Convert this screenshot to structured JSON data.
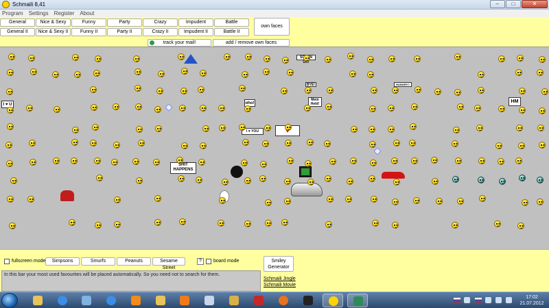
{
  "window": {
    "title": "Schmaili 8,41",
    "minimize": "–",
    "maximize": "□",
    "close": "✕"
  },
  "menu": [
    "Program",
    "Settings",
    "Register",
    "About"
  ],
  "categories": {
    "row1": [
      "General",
      "Nice & Sexy",
      "Funny",
      "Party",
      "Crazy",
      "Impudent",
      "Battle"
    ],
    "row2": [
      "General II",
      "Nice & Sexy II",
      "Funny II",
      "Party II",
      "Crazy II",
      "Impudent II",
      "Battle II"
    ]
  },
  "own_faces": "own faces",
  "track_mail": "track your mail!",
  "add_remove": "add / remove own faces",
  "signs": {
    "schon_ok": "SCHON OK!",
    "oho": "oho!",
    "mein_held": "Mein Held!",
    "hm": "HM",
    "shit_happens": "SHIT HAPPENS",
    "i_love_you": "I ♥ YOU",
    "i_love_u": "I ♥ U",
    "bye": "BYE!",
    "hungry": "HUNGRY?"
  },
  "bottom": {
    "fullscreen": "fullscreen mode",
    "packs": [
      "Simpsons",
      "Smurfs",
      "Peanuts",
      "Sesame Street"
    ],
    "help": "?",
    "board_mode": "board mode",
    "generator_line1": "Smiley",
    "generator_line2": "Generator",
    "fav_text": "In this bar your most used favourites will be placed automatically. So you need not to search for them.",
    "jingle": "Schmaili Jingle",
    "movie": "Schmaili Movie"
  },
  "taskbar": {
    "time": "17:02",
    "date": "21.07.2012",
    "apps": [
      "windows-explorer",
      "internet-explorer",
      "calculator",
      "internet-explorer-2",
      "odnoklassniki",
      "folder",
      "media-player",
      "paint",
      "app-tool",
      "filezilla",
      "firefox",
      "monitor",
      "schmaili",
      "virtualbox"
    ]
  }
}
